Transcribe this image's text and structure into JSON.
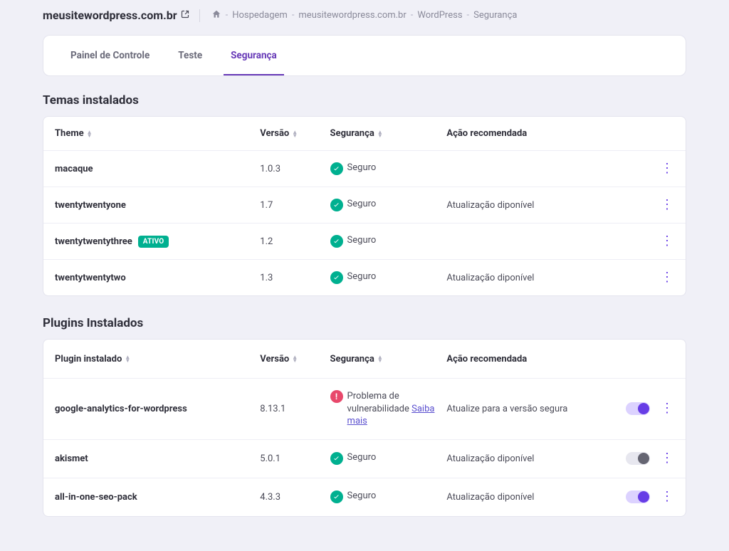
{
  "header": {
    "site": "meusitewordpress.com.br",
    "breadcrumb": {
      "hosting": "Hospedagem",
      "site": "meusitewordpress.com.br",
      "wp": "WordPress",
      "security": "Segurança"
    }
  },
  "tabs": {
    "dashboard": "Painel de Controle",
    "test": "Teste",
    "security": "Segurança"
  },
  "themes": {
    "title": "Temas instalados",
    "headers": {
      "theme": "Theme",
      "version": "Versão",
      "security": "Segurança",
      "action": "Ação recomendada"
    },
    "rows": [
      {
        "name": "macaque",
        "version": "1.0.3",
        "security": "Seguro",
        "action": "",
        "active": false
      },
      {
        "name": "twentytwentyone",
        "version": "1.7",
        "security": "Seguro",
        "action": "Atualização diponível",
        "active": false
      },
      {
        "name": "twentytwentythree",
        "version": "1.2",
        "security": "Seguro",
        "action": "",
        "active": true
      },
      {
        "name": "twentytwentytwo",
        "version": "1.3",
        "security": "Seguro",
        "action": "Atualização diponível",
        "active": false
      }
    ],
    "activeBadge": "ATIVO"
  },
  "plugins": {
    "title": "Plugins Instalados",
    "headers": {
      "plugin": "Plugin instalado",
      "version": "Versão",
      "security": "Segurança",
      "action": "Ação recomendada"
    },
    "rows": [
      {
        "name": "google-analytics-for-wordpress",
        "version": "8.13.1",
        "security": "Problema de vulnerabilidade",
        "securityLink": "Saiba mais",
        "action": "Atualize para a versão segura",
        "warn": true,
        "toggle": "on"
      },
      {
        "name": "akismet",
        "version": "5.0.1",
        "security": "Seguro",
        "action": "Atualização diponível",
        "warn": false,
        "toggle": "off"
      },
      {
        "name": "all-in-one-seo-pack",
        "version": "4.3.3",
        "security": "Seguro",
        "action": "Atualização diponível",
        "warn": false,
        "toggle": "on"
      }
    ]
  }
}
